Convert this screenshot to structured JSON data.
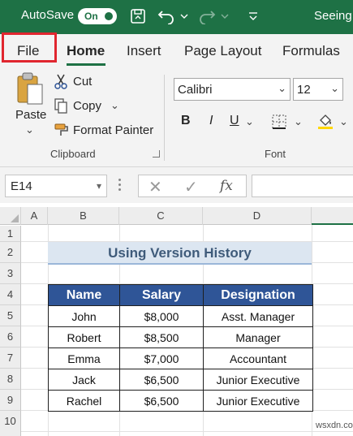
{
  "titlebar": {
    "autosave_label": "AutoSave",
    "toggle_state": "On",
    "doc_title": "Seeing",
    "accent": "#1e7145"
  },
  "tabs": [
    "File",
    "Home",
    "Insert",
    "Page Layout",
    "Formulas"
  ],
  "clipboard": {
    "paste": "Paste",
    "cut": "Cut",
    "copy": "Copy",
    "format_painter": "Format Painter",
    "group_label": "Clipboard"
  },
  "font": {
    "name": "Calibri",
    "size": "12",
    "group_label": "Font",
    "bold": "B",
    "italic": "I",
    "underline": "U"
  },
  "formula_bar": {
    "name_box": "E14",
    "fx": "fx"
  },
  "columns": [
    "A",
    "B",
    "C",
    "D"
  ],
  "rows": [
    "1",
    "2",
    "3",
    "4",
    "5",
    "6",
    "7",
    "8",
    "9",
    "10"
  ],
  "sheet": {
    "title": "Using Version History",
    "headers": [
      "Name",
      "Salary",
      "Designation"
    ],
    "rows": [
      [
        "John",
        "$8,000",
        "Asst. Manager"
      ],
      [
        "Robert",
        "$8,500",
        "Manager"
      ],
      [
        "Emma",
        "$7,000",
        "Accountant"
      ],
      [
        "Jack",
        "$6,500",
        "Junior Executive"
      ],
      [
        "Rachel",
        "$6,500",
        "Junior Executive"
      ]
    ]
  },
  "watermark": "wsxdn.com"
}
